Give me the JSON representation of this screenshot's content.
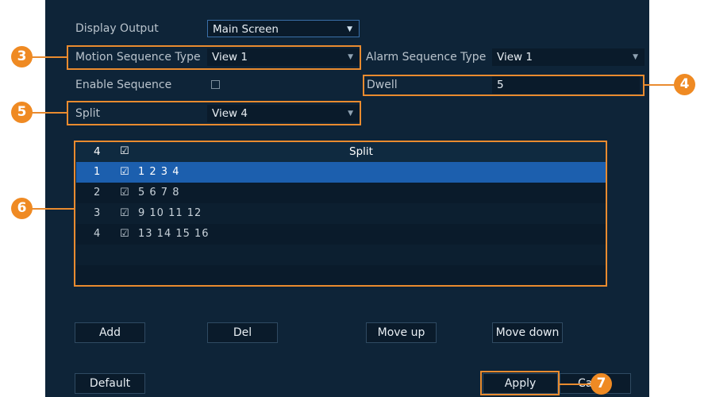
{
  "form": {
    "display_output": {
      "label": "Display Output",
      "value": "Main Screen"
    },
    "motion_sequence_type": {
      "label": "Motion Sequence Type",
      "value": "View 1"
    },
    "alarm_sequence_type": {
      "label": "Alarm Sequence Type",
      "value": "View 1"
    },
    "enable_sequence": {
      "label": "Enable Sequence"
    },
    "dwell": {
      "label": "Dwell",
      "value": "5"
    },
    "split": {
      "label": "Split",
      "value": "View 4"
    }
  },
  "table": {
    "header": {
      "count": "4",
      "title": "Split"
    },
    "rows": [
      {
        "index": "1",
        "channels": "1 2 3 4"
      },
      {
        "index": "2",
        "channels": "5 6 7 8"
      },
      {
        "index": "3",
        "channels": "9 10 11 12"
      },
      {
        "index": "4",
        "channels": "13 14 15 16"
      }
    ]
  },
  "buttons": {
    "add": "Add",
    "del": "Del",
    "move_up": "Move up",
    "move_down": "Move down",
    "default": "Default",
    "apply": "Apply",
    "cancel_partial": "Ca"
  },
  "callouts": {
    "c3": "3",
    "c4": "4",
    "c5": "5",
    "c6": "6",
    "c7": "7"
  },
  "colors": {
    "panel": "#0e2438",
    "accent": "#e98b2f",
    "selected_row": "#1c5fae"
  }
}
